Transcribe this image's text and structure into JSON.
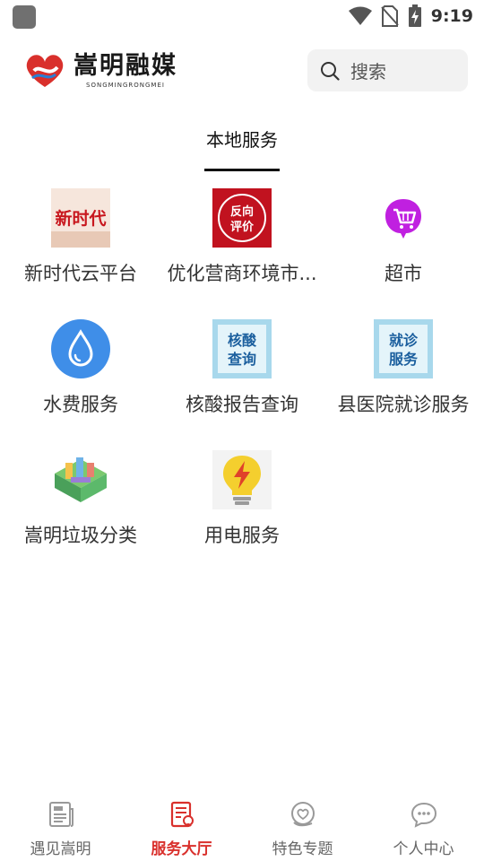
{
  "status_bar": {
    "time": "9:19",
    "icons": [
      "app-icon",
      "wifi-icon",
      "no-sim-icon",
      "battery-charging-icon"
    ]
  },
  "header": {
    "logo_text": "嵩明融媒",
    "logo_subtext": "SONGMINGRONGMEI",
    "search_placeholder": "搜索"
  },
  "tabs": [
    {
      "label": "本地服务",
      "active": true
    }
  ],
  "services": [
    {
      "label": "新时代云平台",
      "icon": "new-era-banner-icon",
      "icon_text": "新时代"
    },
    {
      "label": "优化营商环境市...",
      "icon": "reverse-evaluation-icon",
      "icon_text_1": "反向",
      "icon_text_2": "评价"
    },
    {
      "label": "超市",
      "icon": "shopping-cart-icon"
    },
    {
      "label": "水费服务",
      "icon": "water-drop-icon"
    },
    {
      "label": "核酸报告查询",
      "icon": "nucleic-test-icon",
      "icon_text_1": "核酸",
      "icon_text_2": "查询"
    },
    {
      "label": "县医院就诊服务",
      "icon": "hospital-visit-icon",
      "icon_text_1": "就诊",
      "icon_text_2": "服务"
    },
    {
      "label": "嵩明垃圾分类",
      "icon": "garbage-sorting-city-icon"
    },
    {
      "label": "用电服务",
      "icon": "lightbulb-power-icon"
    }
  ],
  "bottom_nav": [
    {
      "label": "遇见嵩明",
      "icon": "newspaper-icon",
      "active": false
    },
    {
      "label": "服务大厅",
      "icon": "service-hall-icon",
      "active": true
    },
    {
      "label": "特色专题",
      "icon": "heart-hand-icon",
      "active": false
    },
    {
      "label": "个人中心",
      "icon": "chat-bubble-icon",
      "active": false
    }
  ],
  "colors": {
    "accent": "#d9302c",
    "inactive": "#666666",
    "search_bg": "#f2f2f2"
  }
}
